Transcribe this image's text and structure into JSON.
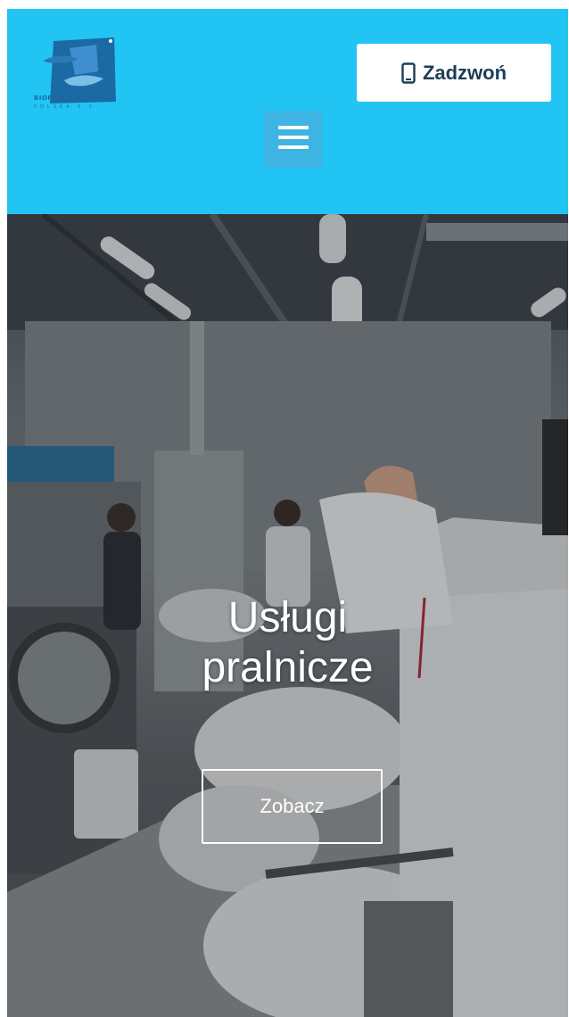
{
  "header": {
    "logo_text": "BIOPROGRAM",
    "logo_subtext": "POLSKA S.C.",
    "call_button_label": "Zadzwoń",
    "menu_icon": "hamburger-icon",
    "phone_icon": "phone-icon"
  },
  "hero": {
    "title_line1": "Usługi",
    "title_line2": "pralnicze",
    "cta_label": "Zobacz"
  },
  "colors": {
    "header_bg": "#22c4f3",
    "menu_bg": "#3db4e2",
    "call_text": "#1c3e57"
  }
}
